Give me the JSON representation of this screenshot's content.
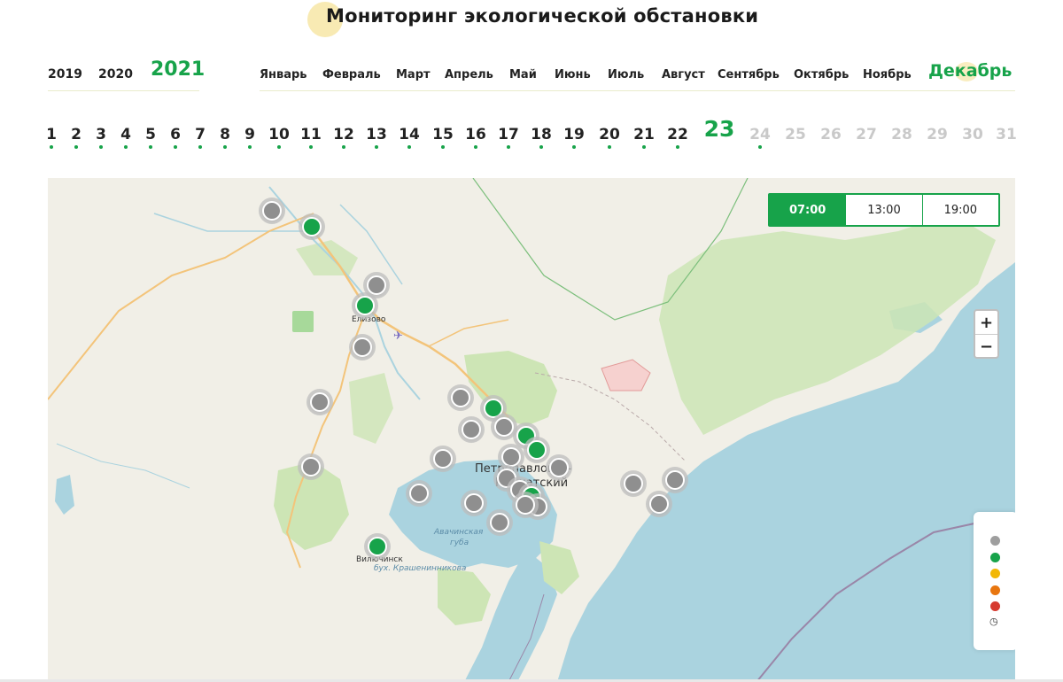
{
  "page": {
    "title": "Мониторинг экологической обстановки"
  },
  "years": [
    {
      "label": "2019",
      "active": false
    },
    {
      "label": "2020",
      "active": false
    },
    {
      "label": "2021",
      "active": true
    }
  ],
  "months": [
    {
      "label": "Январь",
      "active": false
    },
    {
      "label": "Февраль",
      "active": false
    },
    {
      "label": "Март",
      "active": false
    },
    {
      "label": "Апрель",
      "active": false
    },
    {
      "label": "Май",
      "active": false
    },
    {
      "label": "Июнь",
      "active": false
    },
    {
      "label": "Июль",
      "active": false
    },
    {
      "label": "Август",
      "active": false
    },
    {
      "label": "Сентябрь",
      "active": false
    },
    {
      "label": "Октябрь",
      "active": false
    },
    {
      "label": "Ноябрь",
      "active": false
    },
    {
      "label": "Декабрь",
      "active": true
    }
  ],
  "days": {
    "active": "23",
    "enabled": [
      "1",
      "2",
      "3",
      "4",
      "5",
      "6",
      "7",
      "8",
      "9",
      "10",
      "11",
      "12",
      "13",
      "14",
      "15",
      "16",
      "17",
      "18",
      "19",
      "20",
      "21",
      "22",
      "23"
    ],
    "disabled": [
      "24",
      "25",
      "26",
      "27",
      "28",
      "29",
      "30",
      "31"
    ]
  },
  "map": {
    "time_tabs": [
      {
        "label": "07:00",
        "active": true
      },
      {
        "label": "13:00",
        "active": false
      },
      {
        "label": "19:00",
        "active": false
      }
    ],
    "zoom_in": "+",
    "zoom_out": "−",
    "labels": {
      "yelizovo": "Елизово",
      "petropavlovsk_line1": "Петропавловск-",
      "petropavlovsk_line2": "Камчатский",
      "avacha_line1": "Авачинская",
      "avacha_line2": "губа",
      "vilyuchinsk": "Вилючинск",
      "krasheninnikova": "бух. Крашенинникова"
    },
    "legend": {
      "colors": [
        "#9e9e9e",
        "#17a34a",
        "#f2b705",
        "#e8760f",
        "#d63a2f"
      ],
      "history_icon": "history-clock-icon"
    },
    "colors": {
      "accent": "#17a34a",
      "no_data": "#8f8f8f",
      "water": "#aad3df",
      "land": "#f1efe7",
      "forest": "#cde5b5"
    }
  }
}
